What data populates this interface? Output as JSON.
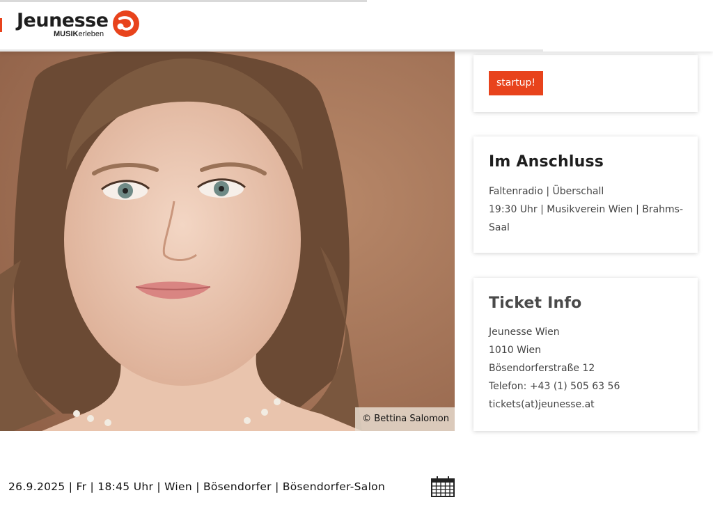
{
  "brand": {
    "name": "Jeunesse",
    "tagline_bold": "MUSIK",
    "tagline_rest": "erleben",
    "accent": "#e8431c"
  },
  "hero": {
    "credit": "© Bettina Salomon"
  },
  "category": {
    "tag": "startup!"
  },
  "follow_up": {
    "title": "Im Anschluss",
    "link": "Faltenradio | Überschall",
    "details": "19:30 Uhr | Musikverein Wien | Brahms-Saal"
  },
  "ticket_info": {
    "title": "Ticket Info",
    "org": "Jeunesse Wien",
    "city": "1010 Wien",
    "street": "Bösendorferstraße 12",
    "phone": "Telefon: +43 (1) 505 63 56",
    "email": "tickets(at)jeunesse.at"
  },
  "event": {
    "line": "26.9.2025 | Fr | 18:45 Uhr | Wien | Bösendorfer | Bösendorfer-Salon",
    "calendar_icon": "calendar-icon"
  }
}
